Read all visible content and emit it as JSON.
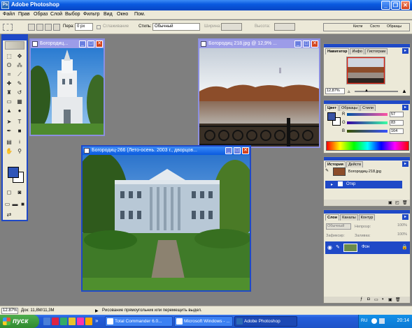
{
  "app": {
    "title": "Adobe Photoshop"
  },
  "menu": [
    "Файл",
    "Прав",
    "Образ",
    "Слой",
    "Выбор",
    "Фильтр",
    "Вид",
    "Окно",
    "Пом."
  ],
  "options": {
    "feather_label": "Пера:",
    "feather_value": "0 px",
    "antialias_label": "Сглаживание",
    "style_label": "Стиль:",
    "style_value": "Обычный",
    "width_label": "Ширина:",
    "height_label": "Высота:",
    "wells": [
      "Кисти",
      "Состо",
      "Образцы"
    ]
  },
  "documents": [
    {
      "title": "Богородиц..."
    },
    {
      "title": "Богородиц 218.jpg @ 12,9% ..."
    },
    {
      "title": "Богородиц-266 (Лето-осень. 2003 г., дворцов..."
    }
  ],
  "navigator": {
    "tabs": [
      "Навигатор",
      "Инфо",
      "Гистограм"
    ],
    "zoom": "12,87%"
  },
  "color": {
    "tabs": [
      "Цвет",
      "Образцы",
      "Стили"
    ],
    "channels": [
      {
        "label": "R",
        "value": "57"
      },
      {
        "label": "G",
        "value": "83"
      },
      {
        "label": "B",
        "value": "164"
      }
    ],
    "fg_color": "#3953a4"
  },
  "history": {
    "tabs": [
      "История",
      "Действ"
    ],
    "snapshot": "Богородиц-218.jpg",
    "step": "Откр"
  },
  "layers": {
    "tabs": [
      "Слои",
      "Каналы",
      "Контур"
    ],
    "blend": "Обычный",
    "opacity_label": "Непрозр:",
    "opacity": "100%",
    "lock_label": "Зафиксир:",
    "fill_label": "Заливка:",
    "fill": "100%",
    "layer_name": "Фон"
  },
  "status": {
    "zoom": "12.87%",
    "doc": "Док: 11,8М/11,3М",
    "hint": "Рисование прямоугольник или перемещить выдел."
  },
  "taskbar": {
    "start": "пуск",
    "tasks": [
      "Total Commander 6.0...",
      "Microsoft Windows - ...",
      "Adobe Photoshop"
    ],
    "lang": "RU",
    "clock": "20:14"
  }
}
